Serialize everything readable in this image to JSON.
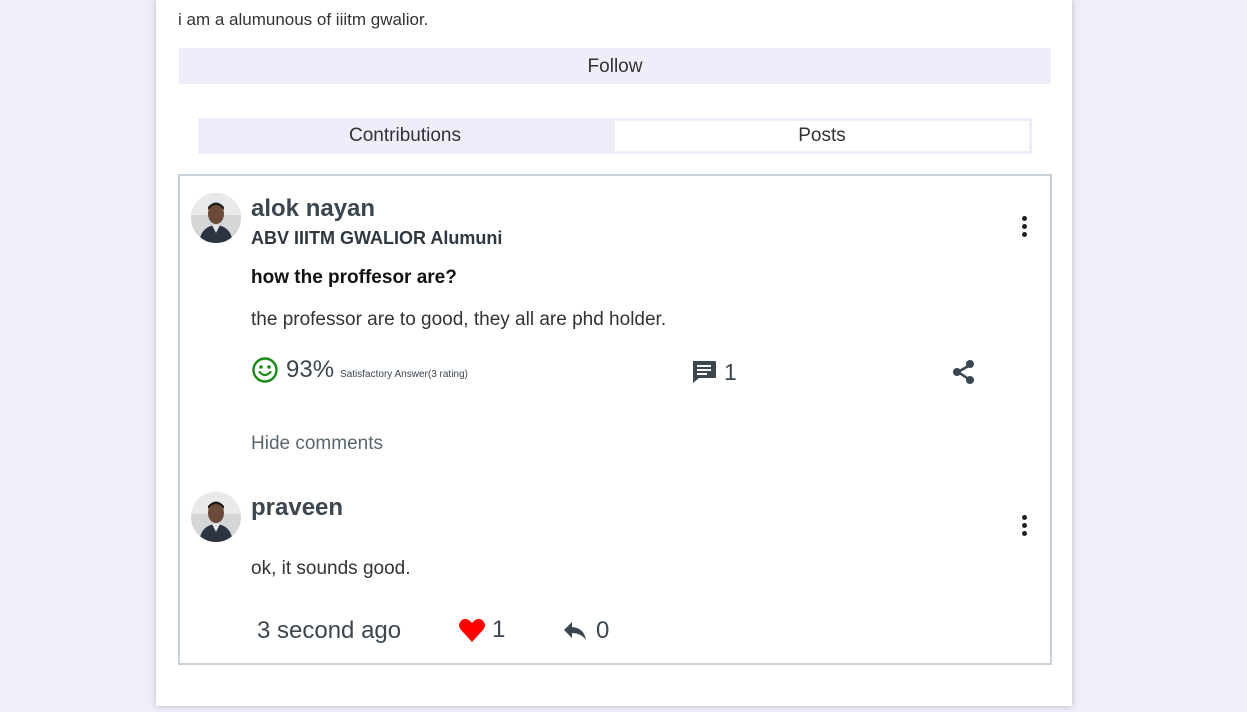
{
  "profile": {
    "bio": "i am a alumunous of iiitm gwalior.",
    "follow_label": "Follow"
  },
  "tabs": [
    {
      "label": "Contributions",
      "active": false
    },
    {
      "label": "Posts",
      "active": true
    }
  ],
  "post": {
    "author": "alok nayan",
    "subtitle": "ABV IIITM GWALIOR Alumuni",
    "question": "how the proffesor are?",
    "answer": "the professor are to good, they all are phd holder.",
    "satisfaction_percent": "93%",
    "satisfaction_label": "Satisfactory Answer(3 rating)",
    "comment_count": "1",
    "hide_comments_label": "Hide comments",
    "icons": {
      "satisfaction": "smile-icon",
      "comments": "comment-icon",
      "share": "share-icon",
      "menu": "more-vert-icon"
    },
    "colors": {
      "satisfaction": "#1a8a1a"
    }
  },
  "comment": {
    "author": "praveen",
    "text": "ok, it sounds good.",
    "time": "3 second ago",
    "like_count": "1",
    "reply_count": "0",
    "icons": {
      "like": "heart-icon",
      "reply": "reply-icon",
      "menu": "more-vert-icon"
    },
    "colors": {
      "like": "#ff0000"
    }
  }
}
